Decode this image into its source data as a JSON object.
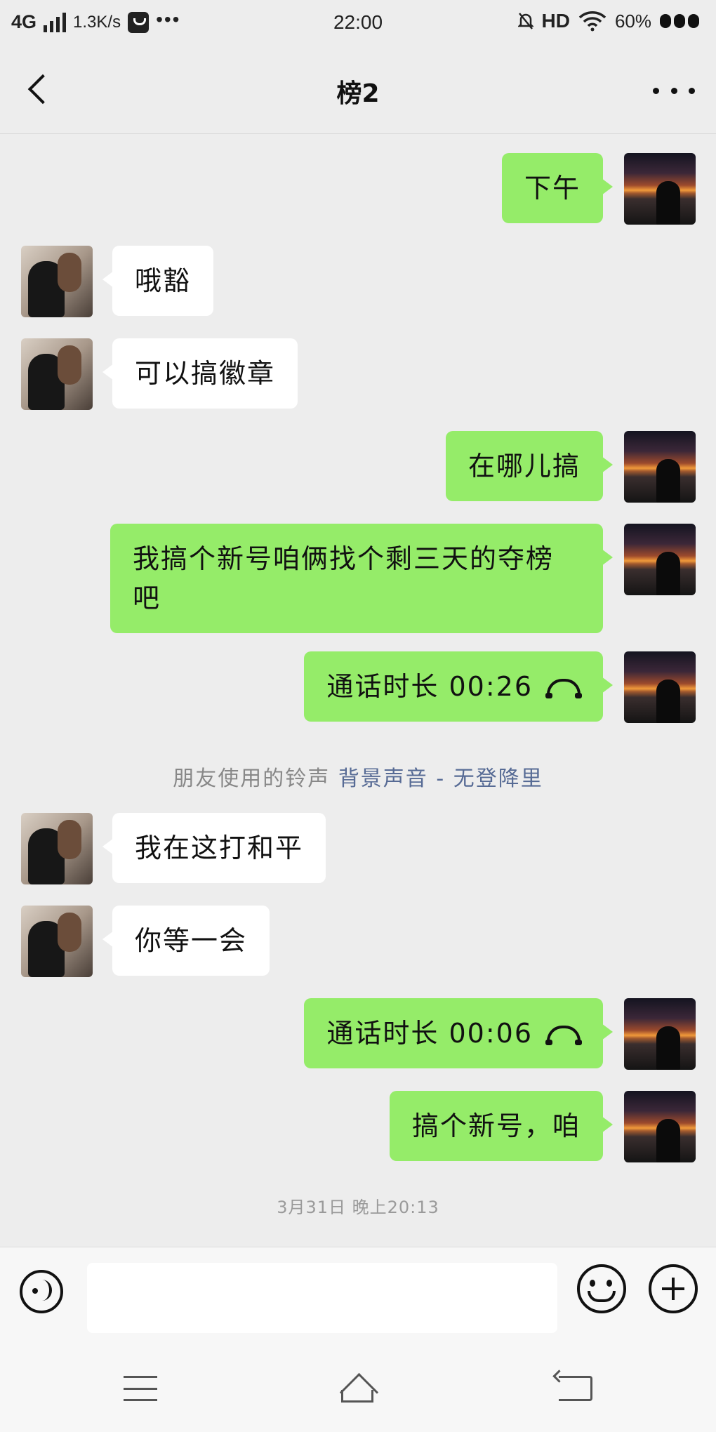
{
  "status_bar": {
    "network": "4G",
    "speed": "1.3K/s",
    "more": "•••",
    "time": "22:00",
    "hd": "HD",
    "battery": "60%"
  },
  "header": {
    "title": "榜2",
    "back_icon": "chevron-left-icon",
    "more_icon": "more-dots-icon"
  },
  "messages": [
    {
      "side": "me",
      "text": "下午"
    },
    {
      "side": "other",
      "text": "哦豁"
    },
    {
      "side": "other",
      "text": "可以搞徽章"
    },
    {
      "side": "me",
      "text": "在哪儿搞"
    },
    {
      "side": "me",
      "text": "我搞个新号咱俩找个剩三天的夺榜吧"
    },
    {
      "side": "me",
      "type": "call",
      "text": "通话时长 00:26"
    },
    {
      "side": "other",
      "text": "我在这打和平"
    },
    {
      "side": "other",
      "text": "你等一会"
    },
    {
      "side": "me",
      "type": "call",
      "text": "通话时长 00:06"
    },
    {
      "side": "me",
      "text": "搞个新号，咱"
    }
  ],
  "system_note": {
    "prefix": "朋友使用的铃声",
    "link": "背景声音 - 无登降里"
  },
  "timestamp": "3月31日 晚上20:13",
  "input_bar": {
    "value": "",
    "placeholder": "",
    "voice_icon": "voice-icon",
    "emoji_icon": "emoji-icon",
    "plus_icon": "plus-icon"
  },
  "nav_bar": {
    "menu_icon": "menu-icon",
    "home_icon": "home-icon",
    "back_icon": "back-icon"
  },
  "colors": {
    "background": "#ededed",
    "my_bubble": "#95ec69",
    "other_bubble": "#ffffff",
    "link": "#576b95"
  }
}
